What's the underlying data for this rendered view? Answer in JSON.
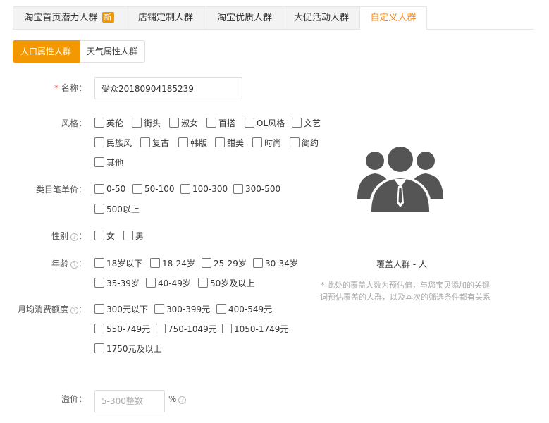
{
  "tabs": [
    {
      "label": "淘宝首页潜力人群",
      "badge": "新"
    },
    {
      "label": "店铺定制人群"
    },
    {
      "label": "淘宝优质人群"
    },
    {
      "label": "大促活动人群"
    },
    {
      "label": "自定义人群",
      "active": true
    }
  ],
  "subtabs": [
    {
      "label": "人口属性人群",
      "active": true
    },
    {
      "label": "天气属性人群"
    }
  ],
  "form": {
    "name": {
      "required_mark": "*",
      "label": "名称：",
      "value": "受众20180904185239"
    },
    "style": {
      "label": "风格：",
      "options": [
        "英伦",
        "街头",
        "淑女",
        "百搭",
        "OL风格",
        "文艺",
        "民族风",
        "复古",
        "韩版",
        "甜美",
        "时尚",
        "简约",
        "其他"
      ]
    },
    "price": {
      "label": "类目笔单价：",
      "options": [
        "0-50",
        "50-100",
        "100-300",
        "300-500",
        "500以上"
      ]
    },
    "gender": {
      "label": "性别",
      "options": [
        "女",
        "男"
      ]
    },
    "age": {
      "label": "年龄",
      "options": [
        "18岁以下",
        "18-24岁",
        "25-29岁",
        "30-34岁",
        "35-39岁",
        "40-49岁",
        "50岁及以上"
      ]
    },
    "spend": {
      "label": "月均消费额度",
      "options": [
        "300元以下",
        "300-399元",
        "400-549元",
        "550-749元",
        "750-1049元",
        "1050-1749元",
        "1750元及以上"
      ]
    },
    "premium": {
      "label": "溢价：",
      "placeholder": "5-300整数",
      "unit": "%"
    }
  },
  "panel": {
    "coverage": "覆盖人群 - 人",
    "note": "* 此处的覆盖人数为预估值，与您宝贝添加的关键词预估覆盖的人群，以及本次的筛选条件都有关系",
    "avatar_icon": "people-group-icon",
    "avatar_color": "#555555"
  },
  "colors": {
    "accent": "#f39800",
    "active_tab_text": "#f3891c"
  }
}
